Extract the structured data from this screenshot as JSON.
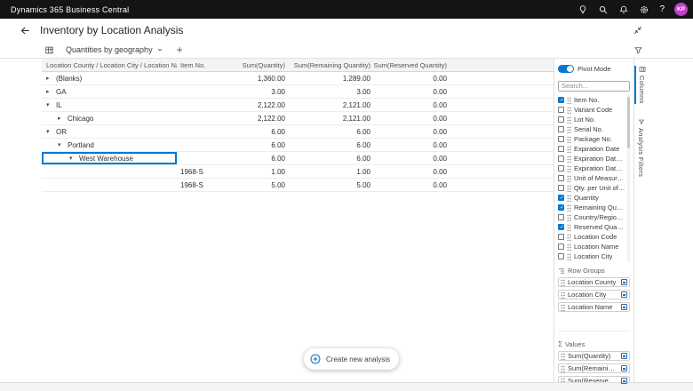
{
  "topbar": {
    "app_title": "Dynamics 365 Business Central",
    "avatar_initials": "KP"
  },
  "header": {
    "title": "Inventory by Location Analysis"
  },
  "toolbar": {
    "active_tab": "Quantities by geography"
  },
  "grid": {
    "columns": {
      "group": "Location County / Location City / Location Name",
      "item_no": "Item No.",
      "qty": "Sum(Quantity)",
      "remaining": "Sum(Remaining Quantity)",
      "reserved": "Sum(Reserved Quantity)"
    },
    "rows": [
      {
        "label": "(Blanks)",
        "level": "0",
        "chevron": "right",
        "item_no": "",
        "qty": "1,360.00",
        "remaining": "1,289.00",
        "reserved": "0.00",
        "selected": "false"
      },
      {
        "label": "GA",
        "level": "0",
        "chevron": "right",
        "item_no": "",
        "qty": "3.00",
        "remaining": "3.00",
        "reserved": "0.00",
        "selected": "false"
      },
      {
        "label": "IL",
        "level": "0",
        "chevron": "down",
        "item_no": "",
        "qty": "2,122.00",
        "remaining": "2,121.00",
        "reserved": "0.00",
        "selected": "false"
      },
      {
        "label": "Chicago",
        "level": "1",
        "chevron": "right",
        "item_no": "",
        "qty": "2,122.00",
        "remaining": "2,121.00",
        "reserved": "0.00",
        "selected": "false"
      },
      {
        "label": "OR",
        "level": "0",
        "chevron": "down",
        "item_no": "",
        "qty": "6.00",
        "remaining": "6.00",
        "reserved": "0.00",
        "selected": "false"
      },
      {
        "label": "Portland",
        "level": "1",
        "chevron": "down",
        "item_no": "",
        "qty": "6.00",
        "remaining": "6.00",
        "reserved": "0.00",
        "selected": "false"
      },
      {
        "label": "West Warehouse",
        "level": "2",
        "chevron": "down",
        "item_no": "",
        "qty": "6.00",
        "remaining": "6.00",
        "reserved": "0.00",
        "selected": "true"
      },
      {
        "label": "",
        "level": "3",
        "chevron": "none",
        "item_no": "1968-S",
        "qty": "1.00",
        "remaining": "1.00",
        "reserved": "0.00",
        "selected": "false"
      },
      {
        "label": "",
        "level": "3",
        "chevron": "none",
        "item_no": "1968-S",
        "qty": "5.00",
        "remaining": "5.00",
        "reserved": "0.00",
        "selected": "false"
      }
    ]
  },
  "panel": {
    "pivot_mode_label": "Pivot Mode",
    "search_placeholder": "Search...",
    "fields": [
      {
        "label": "Item No.",
        "checked": "true"
      },
      {
        "label": "Variant Code",
        "checked": "false"
      },
      {
        "label": "Lot No.",
        "checked": "false"
      },
      {
        "label": "Serial No.",
        "checked": "false"
      },
      {
        "label": "Package No.",
        "checked": "false"
      },
      {
        "label": "Expiration Date",
        "checked": "false"
      },
      {
        "label": "Expiration Date Year",
        "checked": "false"
      },
      {
        "label": "Expiration Date Month",
        "checked": "false"
      },
      {
        "label": "Unit of Measure Code",
        "checked": "false"
      },
      {
        "label": "Qty. per Unit of Measure",
        "checked": "false"
      },
      {
        "label": "Quantity",
        "checked": "true"
      },
      {
        "label": "Remaining Quantity",
        "checked": "true"
      },
      {
        "label": "Country/Region Code",
        "checked": "false"
      },
      {
        "label": "Reserved Quantity",
        "checked": "true"
      },
      {
        "label": "Location Code",
        "checked": "false"
      },
      {
        "label": "Location Name",
        "checked": "false"
      },
      {
        "label": "Location City",
        "checked": "false"
      }
    ],
    "row_groups": {
      "title": "Row Groups",
      "items": [
        "Location County",
        "Location City",
        "Location Name"
      ]
    },
    "values": {
      "title": "Values",
      "items": [
        "Sum(Quantity)",
        "Sum(Remaining Quantity)",
        "Sum(Reserved Quantity)"
      ]
    },
    "side_tabs": [
      "Columns",
      "Analysis Filters"
    ]
  },
  "toast": {
    "label": "Create new analysis"
  },
  "colors": {
    "accent": "#0078d4",
    "avatar_bg": "#c341c9",
    "topbar_bg": "#141414"
  }
}
